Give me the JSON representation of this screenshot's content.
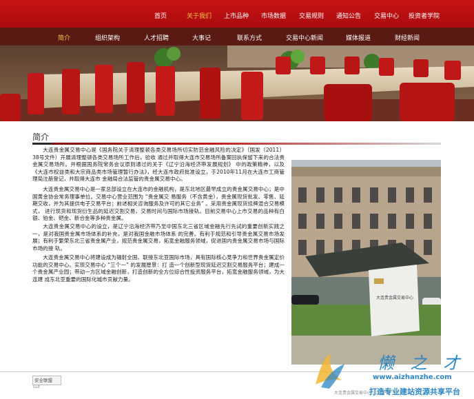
{
  "top_nav": {
    "items": [
      "首页",
      "关于我们",
      "上市品种",
      "市场数据",
      "交易规则",
      "通知公告",
      "交易中心",
      "投资者学院"
    ],
    "active_index": 1
  },
  "sub_nav": {
    "items": [
      "简介",
      "组织架构",
      "人才招聘",
      "大事记",
      "联系方式",
      "交易中心新闻",
      "媒体报道",
      "财经新闻"
    ],
    "active_index": 0
  },
  "main": {
    "section_title": "简介",
    "paragraphs": [
      "大连贵金属交易中心是《国务院关于清理整顿各类交易场所切实防范金融风险的决定》（国发〔2011〕38号文件）开展清理整顿各类交易场所工作后，验收 通过并取得大连市交易场所备案回执保留下来的合法贵金属交易场所。并根据国务院常务会议原则通过的关于《辽宁沿海经济带发展规划》 中的政策精神，以及《大连市权益类和大宗商品类市场管理暂行办法》，经大连市政府批准设立，于2010年11月在大连市工商管理局注册登记，并取得大连市 金融局合法监管的贵金属交易中心。",
      "大连贵金属交易中心是一家总部设立在大连市的金融机构，是东北地区最早成立的贵金属交易中心；是中国黄金协会常务理事单位。交易中心营业范围为 “贵金属交 易服务（不含黄金），贵金属现货批发、零售、延期交收，并为其提供电子交易平台；前述相关咨询服务及许可的其它业务” 。采用贵金属现货挂牌混合交易模式， 进行现货和现货衍生品的延迟交割交易，交易时间与国际市场接轨。目前交易中心上市交易的品种有白银、铂金、钯金、新合金等多种贵金属。",
      "大连贵金属交易中心的设立，是辽宁沿海经济带乃至中国东北三省区域金融先行先试的重要创新实践之一，是对我国贵金属市场体系的补充，是对我国金融市场体系 的完善。有利于规范和引导贵金属交易市场发展；有利于繁荣东北三省贵金属产业，规范贵金属交易，拓宽金融服务领域，促进国内贵金属交易市场与国际市场的接 轨。",
      "大连贵金属交易中心将建设成为辐射全国、联接东北亚国际市场，具有国际核心竞争力和世界贵金属定价功能的交易中心。实现交易中心 “三个一” 的发展愿景：打 造一个创新型现货延迟交割交易服务平台；建成一个贵金属产业园；带动一方区域金融创新，打造创新的全方位综合性投资服务平台，拓宽金融服务领域，为大连建 成东北亚重要的国际化城市贡献力量。"
    ]
  },
  "photo": {
    "sign_text": "大连贵金属交易中心"
  },
  "footer": {
    "badge_label": "安全联盟",
    "badge_sub": "ILLE",
    "text": "大连贵金属交易中心 | 辽ICP备"
  },
  "watermark": {
    "brand": "懒 之 才",
    "url": "www.aizhanzhe.com",
    "slogan": "打造专业建站资源共享平台"
  },
  "colors": {
    "nav_red": "#c81214",
    "subnav_brown": "#5a1a14",
    "active_gold": "#f5c542",
    "watermark_blue": "#2b86c5"
  }
}
